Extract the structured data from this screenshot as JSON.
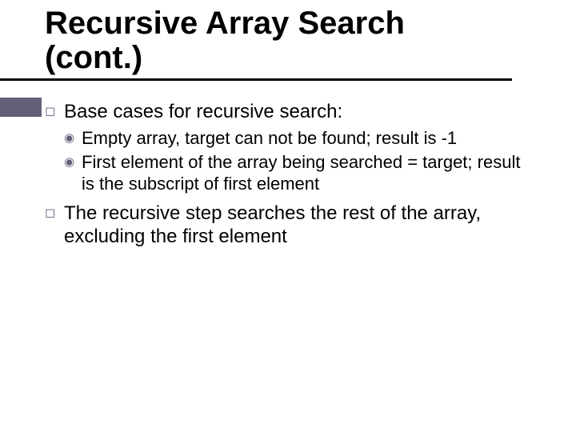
{
  "title_line1": "Recursive Array Search",
  "title_line2": "(cont.)",
  "bullets": [
    {
      "text": "Base cases for recursive search:",
      "sub": [
        {
          "text": "Empty array, target can not be found; result is -1"
        },
        {
          "text": "First element of the array being searched = target; result is the subscript of first element"
        }
      ]
    },
    {
      "text": "The recursive step searches the rest of the array, excluding the first element",
      "sub": []
    }
  ],
  "glyphs": {
    "square": "◻",
    "dot_circle": "◉"
  }
}
